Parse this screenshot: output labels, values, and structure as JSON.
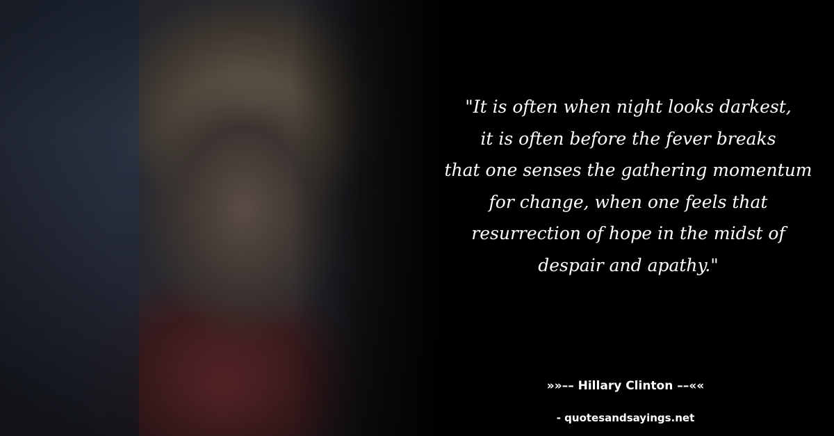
{
  "quote": {
    "text": "\"It is often when night looks darkest,\nit is often before the fever breaks\nthat one senses the gathering momentum\nfor change, when one feels that\nresurrection of hope in the midst of\ndespair and apathy.\""
  },
  "attribution": {
    "author_line": "»»–– Hillary Clinton ––««"
  },
  "source": {
    "site_line": "- quotesandsayings.net"
  },
  "colors": {
    "background": "#000000",
    "text": "#ffffff"
  }
}
